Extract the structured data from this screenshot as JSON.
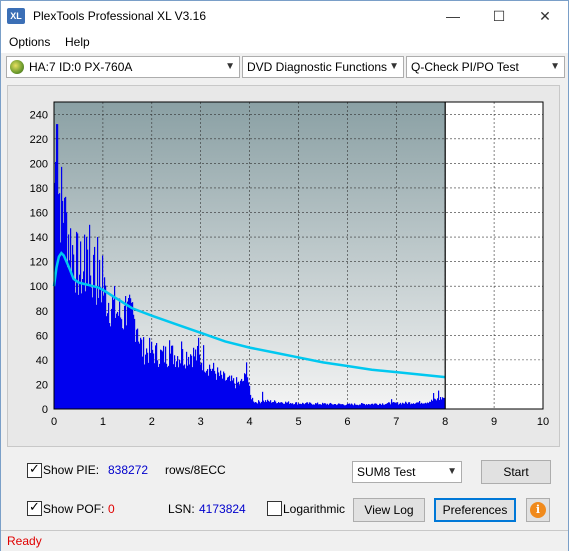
{
  "window": {
    "title": "PlexTools Professional XL V3.16",
    "icon_text": "XL",
    "controls": [
      "minimize-icon",
      "maximize-icon",
      "close-icon"
    ]
  },
  "menu": {
    "options": "Options",
    "help": "Help"
  },
  "toolbar": {
    "drive": "HA:7 ID:0  PX-760A",
    "function": "DVD Diagnostic Functions",
    "test": "Q-Check PI/PO Test"
  },
  "chart_data": {
    "type": "bar",
    "x_ticks": [
      "0",
      "1",
      "2",
      "3",
      "4",
      "5",
      "6",
      "7",
      "8",
      "9",
      "10"
    ],
    "y_ticks": [
      "0",
      "20",
      "40",
      "60",
      "80",
      "100",
      "120",
      "140",
      "160",
      "180",
      "200",
      "220",
      "240"
    ],
    "xlim": [
      0,
      10
    ],
    "ylim": [
      0,
      250
    ],
    "grid": true,
    "marker_x": 8,
    "colors": {
      "pie_bars": "#0000ee",
      "sum8_line": "#00c8f0",
      "plot_bg_top": "#8aa0a4",
      "plot_bg_bottom": "#f4f4f4"
    },
    "pie_envelope": [
      [
        0.0,
        200
      ],
      [
        0.04,
        222
      ],
      [
        0.08,
        195
      ],
      [
        0.12,
        185
      ],
      [
        0.18,
        172
      ],
      [
        0.25,
        160
      ],
      [
        0.32,
        148
      ],
      [
        0.4,
        135
      ],
      [
        0.5,
        122
      ],
      [
        0.6,
        118
      ],
      [
        0.7,
        112
      ],
      [
        0.8,
        120
      ],
      [
        0.9,
        112
      ],
      [
        1.0,
        105
      ],
      [
        1.1,
        96
      ],
      [
        1.2,
        90
      ],
      [
        1.3,
        85
      ],
      [
        1.4,
        80
      ],
      [
        1.5,
        84
      ],
      [
        1.6,
        78
      ],
      [
        1.7,
        76
      ],
      [
        1.74,
        60
      ],
      [
        1.8,
        52
      ],
      [
        2.0,
        50
      ],
      [
        2.2,
        47
      ],
      [
        2.4,
        48
      ],
      [
        2.6,
        46
      ],
      [
        2.8,
        49
      ],
      [
        3.0,
        44
      ],
      [
        3.2,
        36
      ],
      [
        3.4,
        28
      ],
      [
        3.6,
        24
      ],
      [
        3.8,
        22
      ],
      [
        3.95,
        30
      ],
      [
        4.0,
        12
      ],
      [
        4.1,
        6
      ],
      [
        4.3,
        7
      ],
      [
        5.0,
        5
      ],
      [
        6.0,
        4
      ],
      [
        7.0,
        5
      ],
      [
        7.6,
        6
      ],
      [
        7.8,
        8
      ],
      [
        7.95,
        10
      ],
      [
        8.0,
        10
      ]
    ],
    "pie_spikes": [
      [
        0.05,
        232
      ],
      [
        0.2,
        172
      ],
      [
        0.45,
        140
      ],
      [
        0.62,
        142
      ],
      [
        0.65,
        140
      ],
      [
        0.72,
        150
      ],
      [
        0.82,
        132
      ],
      [
        0.88,
        140
      ],
      [
        0.98,
        125
      ],
      [
        1.45,
        92
      ],
      [
        1.6,
        87
      ],
      [
        2.35,
        56
      ],
      [
        2.6,
        55
      ],
      [
        2.95,
        58
      ],
      [
        3.05,
        52
      ],
      [
        3.92,
        38
      ],
      [
        4.25,
        14
      ],
      [
        6.9,
        8
      ],
      [
        7.75,
        13
      ],
      [
        7.85,
        15
      ]
    ],
    "sum8_line": [
      [
        0.0,
        100
      ],
      [
        0.05,
        115
      ],
      [
        0.1,
        124
      ],
      [
        0.15,
        127
      ],
      [
        0.2,
        125
      ],
      [
        0.3,
        116
      ],
      [
        0.4,
        106
      ],
      [
        0.5,
        103
      ],
      [
        0.6,
        102
      ],
      [
        0.7,
        101
      ],
      [
        0.8,
        100
      ],
      [
        0.9,
        99
      ],
      [
        1.0,
        97
      ],
      [
        1.2,
        92
      ],
      [
        1.4,
        87
      ],
      [
        1.6,
        82
      ],
      [
        1.8,
        79
      ],
      [
        2.0,
        76
      ],
      [
        2.5,
        69
      ],
      [
        3.0,
        62
      ],
      [
        3.5,
        55
      ],
      [
        4.0,
        50
      ],
      [
        4.5,
        46
      ],
      [
        5.0,
        42
      ],
      [
        5.5,
        38
      ],
      [
        6.0,
        35
      ],
      [
        6.5,
        32
      ],
      [
        7.0,
        30
      ],
      [
        7.5,
        28
      ],
      [
        8.0,
        26
      ]
    ]
  },
  "controls": {
    "show_pie_label": "Show PIE:",
    "pie_value": "838272",
    "pie_unit": "rows/8ECC",
    "show_pof_label": "Show POF:",
    "pof_value": "0",
    "lsn_label": "LSN:",
    "lsn_value": "4173824",
    "logarithmic_label": "Logarithmic",
    "test_select": "SUM8 Test",
    "start_button": "Start",
    "view_log_button": "View Log",
    "preferences_button": "Preferences",
    "colors": {
      "value_blue": "#0000cc",
      "value_red": "#e00000"
    }
  },
  "status": {
    "text": "Ready"
  }
}
